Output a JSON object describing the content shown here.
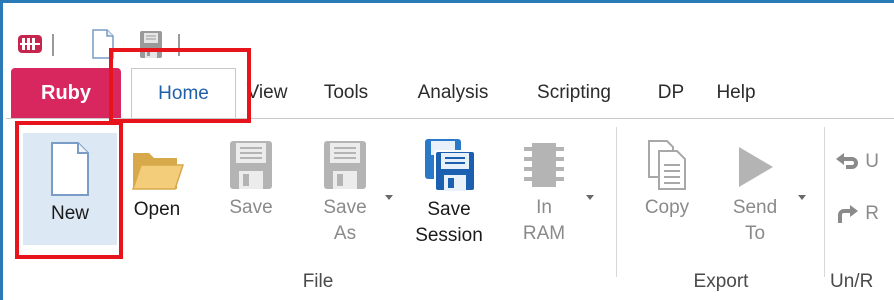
{
  "quick_access": {
    "logo_icon": "app-logo-icon",
    "new_icon": "new-document-icon",
    "save_icon": "save-disk-icon"
  },
  "tabs": [
    {
      "label": "Ruby"
    },
    {
      "label": "Home"
    },
    {
      "label": "View"
    },
    {
      "label": "Tools"
    },
    {
      "label": "Analysis"
    },
    {
      "label": "Scripting"
    },
    {
      "label": "DP"
    },
    {
      "label": "Help"
    }
  ],
  "ribbon": {
    "file": {
      "label": "File",
      "new": "New",
      "open": "Open",
      "save": "Save",
      "save_as_1": "Save",
      "save_as_2": "As",
      "save_session_1": "Save",
      "save_session_2": "Session",
      "in_ram_1": "In",
      "in_ram_2": "RAM"
    },
    "export": {
      "label": "Export",
      "copy": "Copy",
      "send_to_1": "Send",
      "send_to_2": "To"
    },
    "undo_redo": {
      "label": "Un/R",
      "undo": "U",
      "redo": "R"
    }
  },
  "colors": {
    "ruby_tab": "#d8275f",
    "home_tab_text": "#1f5fa8",
    "annotation": "#e8141c",
    "new_highlight": "#dde8f5"
  }
}
